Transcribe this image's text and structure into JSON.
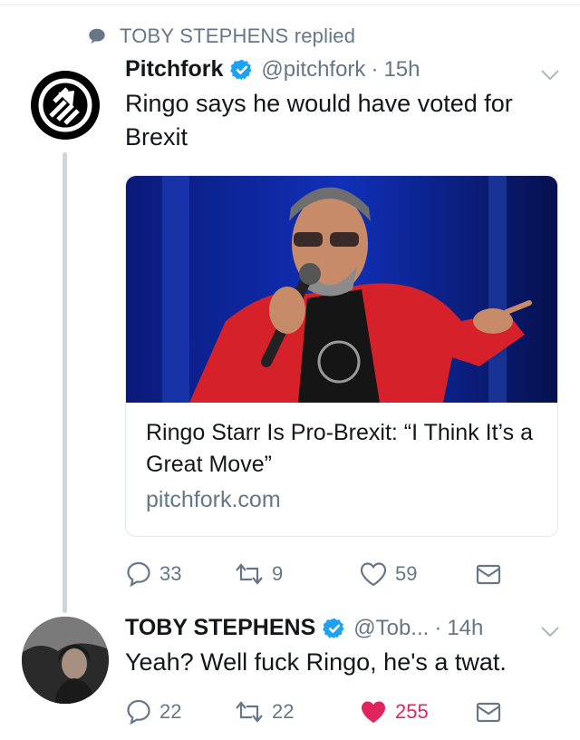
{
  "context": {
    "icon": "speech-bubble-icon",
    "text": "TOBY STEPHENS replied"
  },
  "tweet1": {
    "name": "Pitchfork",
    "handle": "@pitchfork",
    "separator": "·",
    "time": "15h",
    "text": "Ringo says he would have voted for Brexit",
    "card": {
      "title": "Ringo Starr Is Pro-Brexit: “I Think It’s a Great Move”",
      "domain": "pitchfork.com"
    },
    "actions": {
      "replies": "33",
      "retweets": "9",
      "likes": "59"
    }
  },
  "tweet2": {
    "name": "TOBY STEPHENS",
    "handle": "@Tob...",
    "separator": "·",
    "time": "14h",
    "text": "Yeah? Well fuck Ringo, he's a twat.",
    "actions": {
      "replies": "22",
      "retweets": "22",
      "likes": "255"
    }
  },
  "colors": {
    "verified": "#1da1f2",
    "like_active": "#e0245e",
    "secondary_text": "#657786",
    "thread_line": "#ccd6dd"
  }
}
